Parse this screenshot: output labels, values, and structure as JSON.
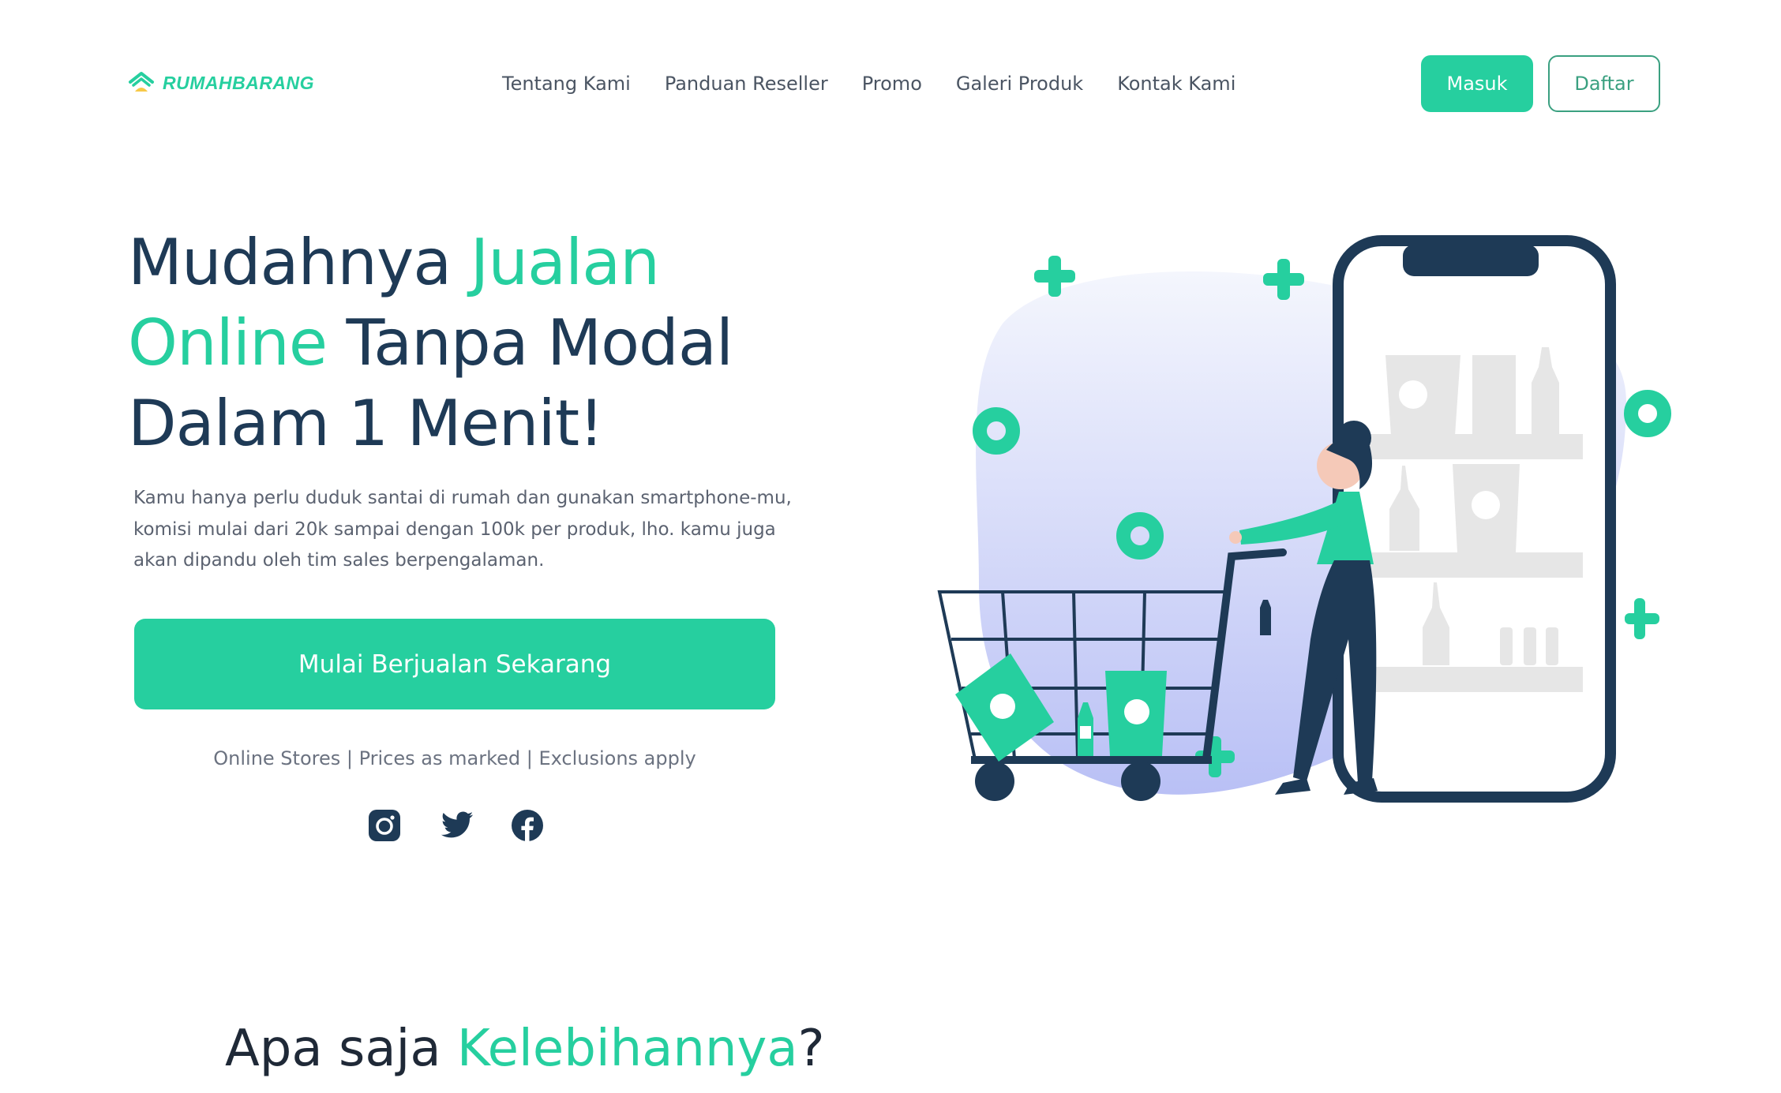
{
  "brand": {
    "name": "RUMAHBARANG",
    "color": "#26cf9f"
  },
  "nav": {
    "items": [
      "Tentang Kami",
      "Panduan Reseller",
      "Promo",
      "Galeri Produk",
      "Kontak Kami"
    ]
  },
  "auth": {
    "login_label": "Masuk",
    "register_label": "Daftar"
  },
  "hero": {
    "title_part1": "Mudahnya ",
    "title_accent1": "Jualan",
    "title_accent2": "Online",
    "title_part2": " Tanpa Modal",
    "title_part3": "Dalam 1 Menit!",
    "description": "Kamu hanya perlu duduk santai di rumah dan gunakan smartphone-mu, komisi mulai dari 20k sampai dengan 100k per produk, lho. kamu juga akan dipandu oleh tim sales berpengalaman.",
    "cta_label": "Mulai Berjualan Sekarang",
    "fineprint": "Online Stores | Prices as marked | Exclusions apply"
  },
  "social": {
    "icons": [
      "instagram-icon",
      "twitter-icon",
      "facebook-icon"
    ]
  },
  "advantages": {
    "title_part1": "Apa saja ",
    "title_accent": "Kelebihannya",
    "title_part2": "?"
  },
  "colors": {
    "accent": "#26cf9f",
    "dark": "#1e3a56",
    "text": "#4b5563"
  }
}
